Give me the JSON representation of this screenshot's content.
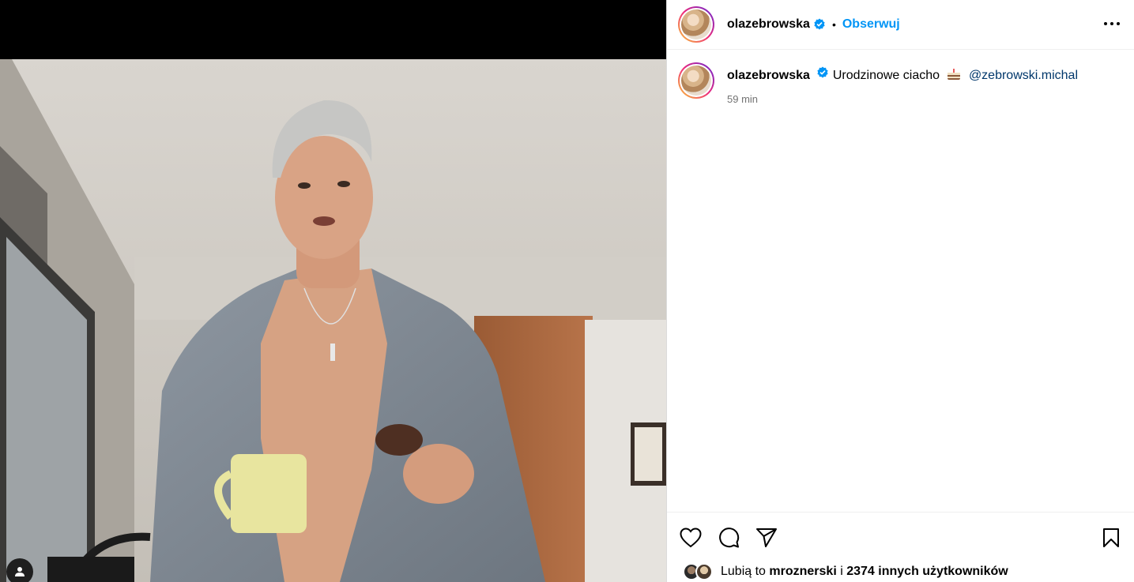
{
  "post": {
    "author": "olazebrowska",
    "follow_label": "Obserwuj",
    "separator": "•",
    "caption_author": "olazebrowska",
    "caption_text": "Urodzinowe ciacho",
    "caption_emoji": "cake-emoji",
    "mention": "@zebrowski.michal",
    "time": "59 min",
    "likes_prefix": "Lubią to",
    "likes_user": "mroznerski",
    "likes_conjunction": "i",
    "likes_others": "2374 innych użytkowników"
  },
  "icons": [
    "verified-icon",
    "more-options-icon",
    "heart-icon",
    "comment-icon",
    "share-icon",
    "bookmark-icon",
    "user-tag-icon"
  ],
  "colors": {
    "follow_blue": "#0095f6",
    "mention_navy": "#00376b",
    "verified_blue": "#0095f6",
    "muted_text": "#737373"
  }
}
